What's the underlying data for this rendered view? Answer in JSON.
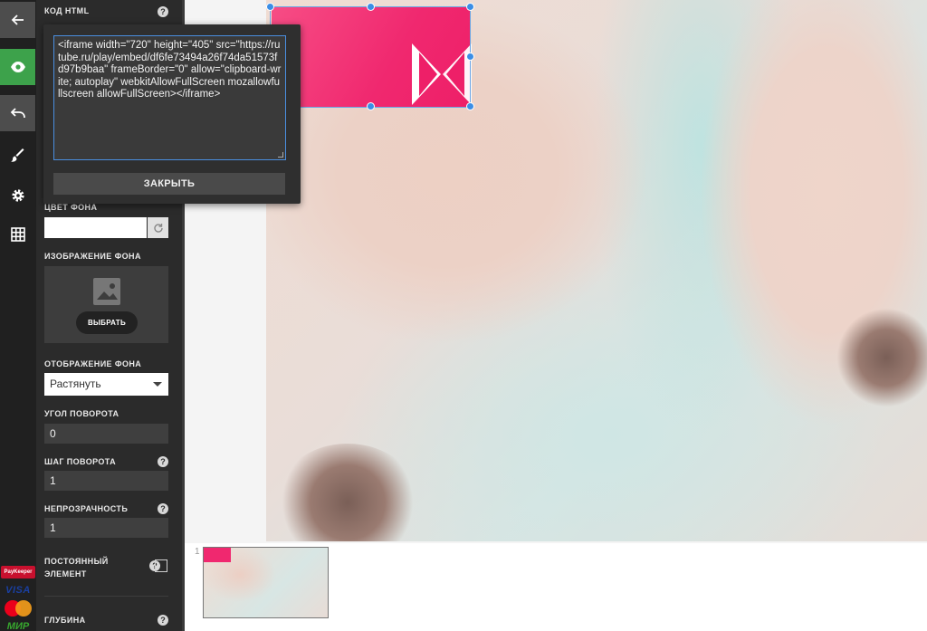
{
  "panel": {
    "html_code_label": "КОД HTML",
    "bg_color_label": "ЦВЕТ ФОНА",
    "bg_image_label": "ИЗОБРАЖЕНИЕ ФОНА",
    "choose_button": "ВЫБРАТЬ",
    "bg_display_label": "ОТОБРАЖЕНИЕ ФОНА",
    "bg_display_value": "Растянуть",
    "rotation_angle_label": "УГОЛ ПОВОРОТА",
    "rotation_angle_value": "0",
    "rotation_step_label": "ШАГ ПОВОРОТА",
    "rotation_step_value": "1",
    "opacity_label": "НЕПРОЗРАЧНОСТЬ",
    "opacity_value": "1",
    "permanent_label_1": "ПОСТОЯННЫЙ",
    "permanent_label_2": "ЭЛЕМЕНТ",
    "depth_label": "ГЛУБИНА",
    "help_glyph": "?"
  },
  "popup": {
    "code": "<iframe width=\"720\" height=\"405\" src=\"https://rutube.ru/play/embed/df6fe73494a26f74da51573fd97b9baa\" frameBorder=\"0\" allow=\"clipboard-write; autoplay\" webkitAllowFullScreen mozallowfullscreen allowFullScreen></iframe>",
    "close_button": "ЗАКРЫТЬ"
  },
  "payments": {
    "paykeeper": "PayKeeper",
    "visa": "VISA",
    "mir": "МИР"
  },
  "slides": {
    "current_number": "1"
  },
  "colors": {
    "accent_green": "#3da24b",
    "embed_pink": "#f0286f",
    "selection_blue": "#3b8ee6"
  }
}
